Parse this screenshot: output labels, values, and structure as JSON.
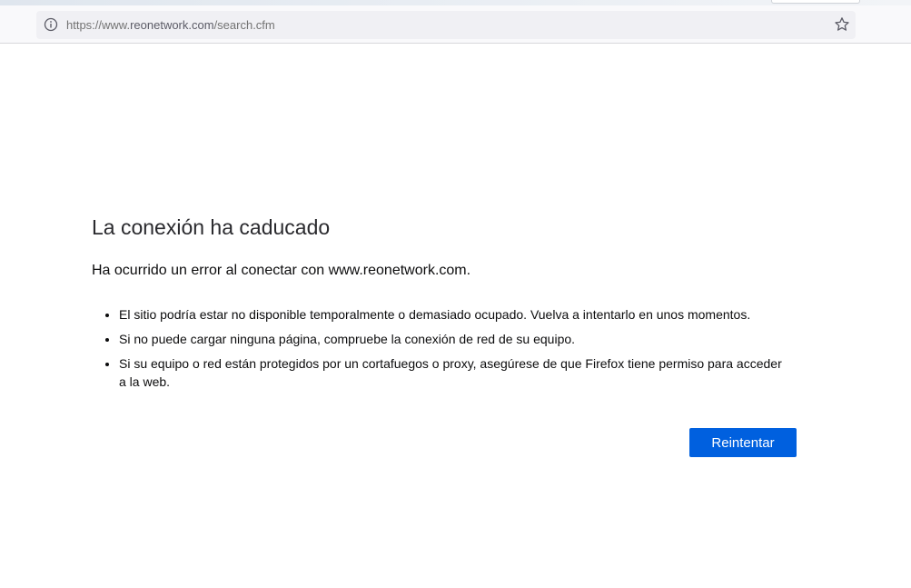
{
  "browser": {
    "url_prefix": "https://www.",
    "url_host": "reonetwork.com",
    "url_path": "/search.cfm",
    "info_icon": "info-icon",
    "bookmark_icon": "star-icon"
  },
  "error": {
    "title": "La conexión ha caducado",
    "subtitle": "Ha ocurrido un error al conectar con www.reonetwork.com.",
    "reasons": [
      "El sitio podría estar no disponible temporalmente o demasiado ocupado. Vuelva a intentarlo en unos momentos.",
      "Si no puede cargar ninguna página, compruebe la conexión de red de su equipo.",
      "Si su equipo o red están protegidos por un cortafuegos o proxy, asegúrese de que Firefox tiene permiso para acceder a la web."
    ],
    "retry_label": "Reintentar"
  },
  "colors": {
    "accent": "#0060df",
    "url_bar": "#f0f0f4",
    "toolbar": "#f9f9fb"
  }
}
